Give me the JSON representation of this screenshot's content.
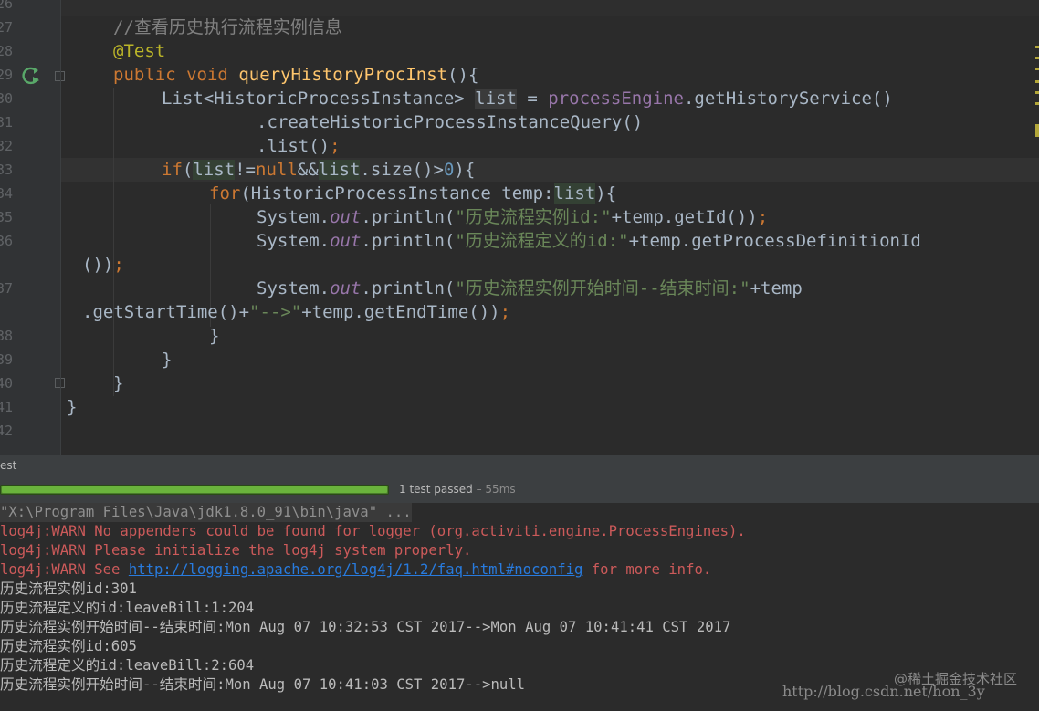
{
  "editor": {
    "line_numbers": [
      "26",
      "27",
      "28",
      "29",
      "30",
      "31",
      "32",
      "33",
      "34",
      "35",
      "36",
      "",
      "37",
      "",
      "38",
      "39",
      "40",
      "41",
      "42"
    ],
    "code": {
      "comment": "//查看历史执行流程实例信息",
      "annotation": "@Test",
      "kw_public": "public",
      "kw_void": "void",
      "method_name": "queryHistoryProcInst",
      "paren_open": "(){",
      "l30_a": "List<HistoricProcessInstance> ",
      "var_list": "list",
      "l30_b": " = ",
      "field_engine": "processEngine",
      "l30_c": ".getHistoryService()",
      "l31": ".createHistoricProcessInstanceQuery()",
      "l32_a": ".list()",
      "semi": ";",
      "kw_if": "if",
      "paren": "(",
      "l33_ne": "!=",
      "kw_null": "null",
      "l33_and": "&&",
      "l33_size": ".size()>",
      "num_zero": "0",
      "brace_close_open": "){",
      "kw_for": "for",
      "l34_b": "(HistoricProcessInstance temp:",
      "sys": "System.",
      "static_out": "out",
      "println": ".println(",
      "str_35": "\"历史流程实例id:\"",
      "l35_tail": "+temp.getId())",
      "str_36": "\"历史流程定义的id:\"",
      "l36_tail": "+temp.getProcessDefinitionId",
      "l36_wrap": "())",
      "str_37": "\"历史流程实例开始时间--结束时间:\"",
      "l37_tail": "+temp",
      "l37_wrap_a": ".getStartTime()+",
      "str_arrow": "\"-->\"",
      "l37_wrap_b": "+temp.getEndTime())",
      "brace": "}"
    }
  },
  "tool_window": {
    "title": "est"
  },
  "test_runner": {
    "progress": 1.0,
    "status": "1 test passed",
    "duration": " – 55ms"
  },
  "console": {
    "lines": [
      "\"X:\\Program Files\\Java\\jdk1.8.0_91\\bin\\java\" ...",
      "log4j:WARN No appenders could be found for logger (org.activiti.engine.ProcessEngines).",
      "log4j:WARN Please initialize the log4j system properly.",
      "log4j:WARN See ",
      "http://logging.apache.org/log4j/1.2/faq.html#noconfig",
      " for more info.",
      "历史流程实例id:301",
      "历史流程定义的id:leaveBill:1:204",
      "历史流程实例开始时间--结束时间:Mon Aug 07 10:32:53 CST 2017-->Mon Aug 07 10:41:41 CST 2017",
      "历史流程实例id:605",
      "历史流程定义的id:leaveBill:2:604",
      "历史流程实例开始时间--结束时间:Mon Aug 07 10:41:03 CST 2017-->null"
    ]
  },
  "watermark": {
    "brand": "@稀土掘金技术社区",
    "url": "http://blog.csdn.net/hon_3y"
  },
  "colors": {
    "keyword": "#cc7832",
    "string": "#6a8759",
    "method": "#ffc66d",
    "error": "#cc5a5a",
    "link": "#287bde",
    "progress": "#6ab33c"
  },
  "icons": [
    "run-test-icon",
    "fold-icon"
  ]
}
